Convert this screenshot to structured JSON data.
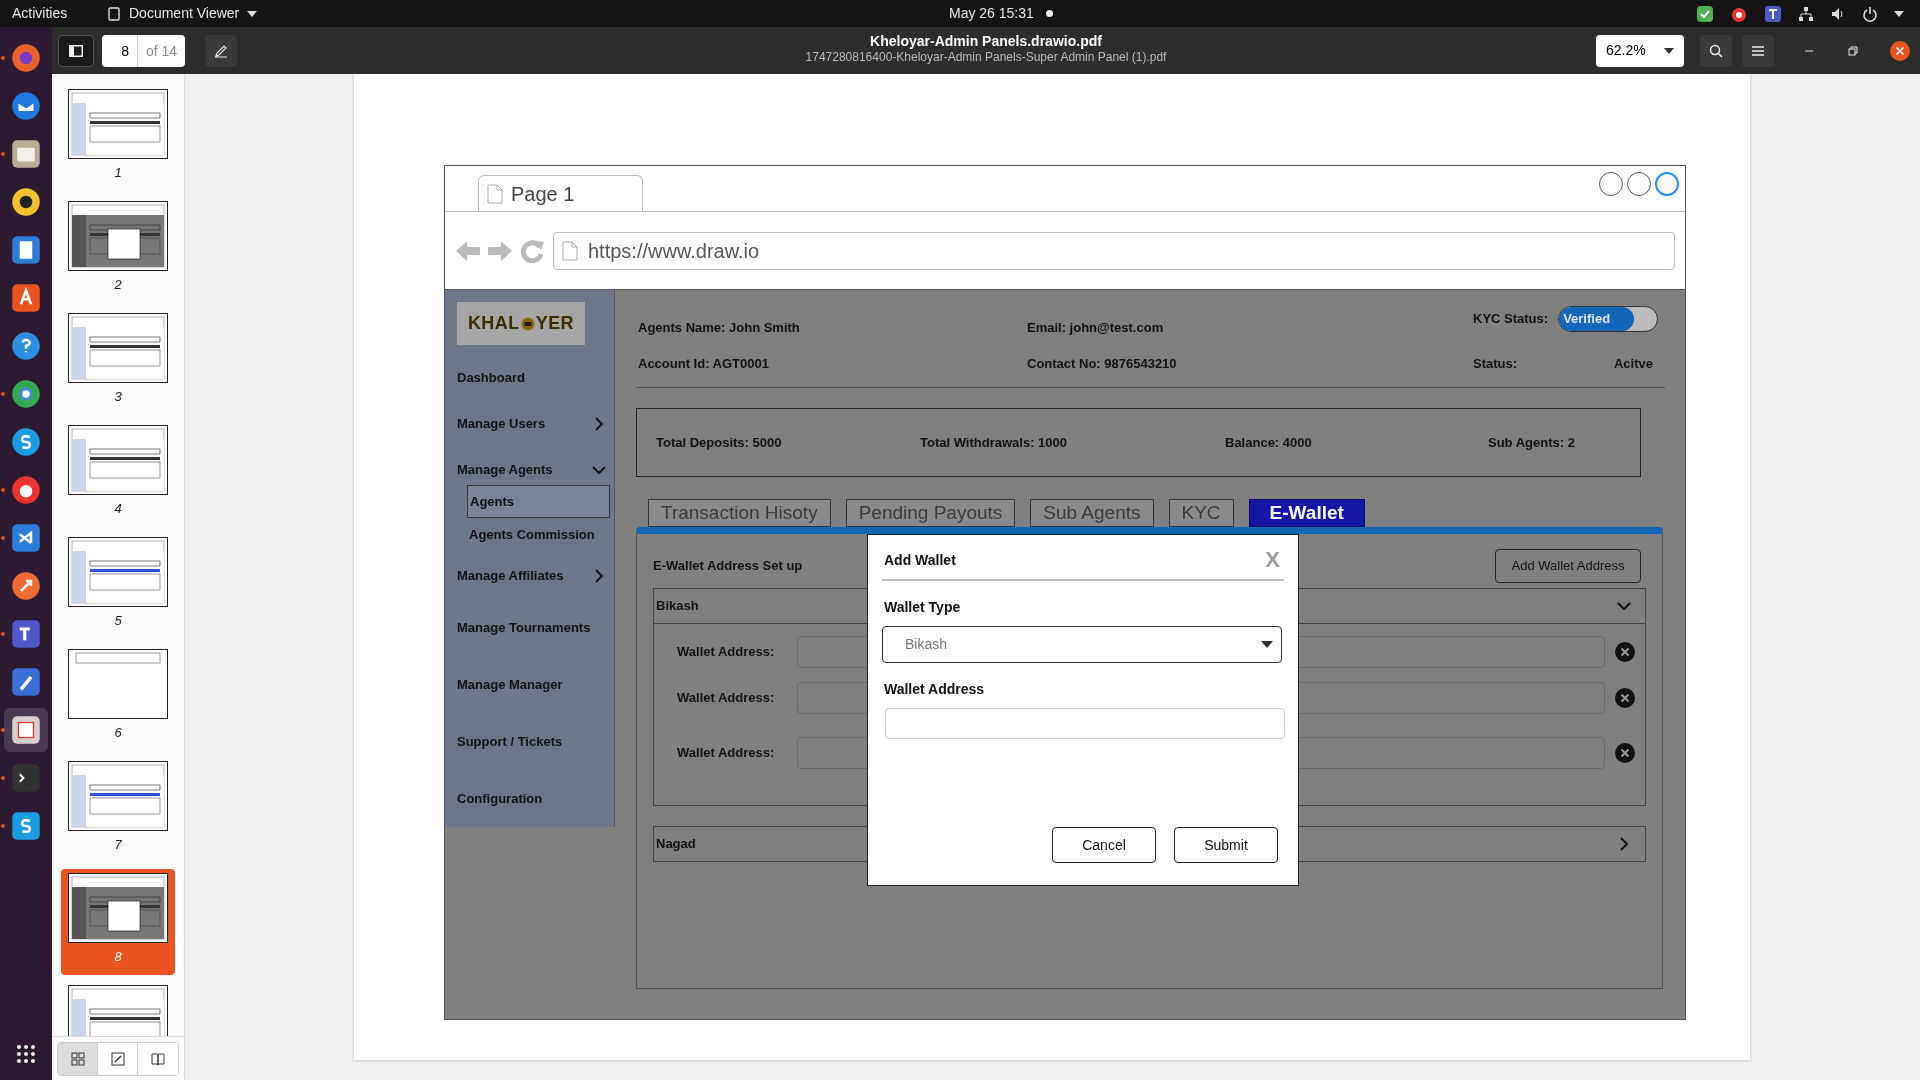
{
  "topbar": {
    "activities": "Activities",
    "app": "Document Viewer",
    "clock": "May 26  15:31"
  },
  "dock": [
    {
      "running": true
    },
    {
      "running": false
    },
    {
      "running": true
    },
    {
      "running": false
    },
    {
      "running": false
    },
    {
      "running": false
    },
    {
      "running": false
    },
    {
      "running": true
    },
    {
      "running": false
    },
    {
      "running": true
    },
    {
      "running": true
    },
    {
      "running": false
    },
    {
      "running": true
    },
    {
      "running": false
    },
    {
      "running": true
    },
    {
      "running": true
    },
    {
      "running": true
    }
  ],
  "viewer": {
    "page": "8",
    "page_count": "of 14",
    "title": "Kheloyar-Admin Panels.drawio.pdf",
    "subtitle": "1747280816400-Kheloyar-Admin Panels-Super Admin Panel (1).pdf",
    "zoom": "62.2%"
  },
  "thumbnails": [
    {
      "label": "1",
      "selected": false
    },
    {
      "label": "2",
      "selected": false
    },
    {
      "label": "3",
      "selected": false
    },
    {
      "label": "4",
      "selected": false
    },
    {
      "label": "5",
      "selected": false
    },
    {
      "label": "6",
      "selected": false
    },
    {
      "label": "7",
      "selected": false
    },
    {
      "label": "8",
      "selected": true
    },
    {
      "selected": false
    }
  ],
  "sidebar_modes": [
    {
      "selected": true
    },
    {
      "selected": false
    },
    {
      "selected": false
    }
  ],
  "mockup": {
    "tab": "Page 1",
    "url": "https://www.draw.io",
    "logo": [
      "KHAL",
      "YER"
    ],
    "nav": [
      {
        "label": "Dashboard"
      },
      {
        "label": "Manage Users",
        "expanded": false
      },
      {
        "label": "Manage Agents",
        "expanded": true,
        "children": [
          {
            "label": "Agents",
            "selected": true
          },
          {
            "label": "Agents Commission",
            "selected": false
          }
        ]
      },
      {
        "label": "Manage Affiliates",
        "expanded": false
      },
      {
        "label": "Manage Tournaments"
      },
      {
        "label": "Manage Manager"
      },
      {
        "label": "Support / Tickets"
      },
      {
        "label": "Configuration"
      }
    ],
    "agent": {
      "name": "Agents Name: John Smith",
      "account": "Account Id: AGT0001",
      "email": "Email: john@test.com",
      "contact": "Contact No: 9876543210",
      "kyc_label": "KYC Status:",
      "kyc_toggle": "Verified",
      "kyc_on": true,
      "status_label": "Status:",
      "status": "Acitve"
    },
    "summary": [
      "Total Deposits: 5000",
      "Total Withdrawals: 1000",
      "Balance: 4000",
      "Sub Agents: 2"
    ],
    "tabs": [
      {
        "label": "Transaction Hisoty",
        "selected": false
      },
      {
        "label": "Pending Payouts",
        "selected": false
      },
      {
        "label": "Sub Agents",
        "selected": false
      },
      {
        "label": "KYC",
        "selected": false
      },
      {
        "label": "E-Wallet",
        "selected": true
      }
    ],
    "wallet": {
      "title": "E-Wallet Address Set up",
      "add_button": "Add Wallet Address",
      "groups": [
        {
          "name": "Bikash",
          "expanded": true,
          "addresses": [
            {
              "label": "Wallet Address:"
            },
            {
              "label": "Wallet Address:"
            },
            {
              "label": "Wallet Address:"
            }
          ]
        },
        {
          "name": "Nagad",
          "expanded": false
        }
      ]
    },
    "modal": {
      "title": "Add Wallet",
      "close": "X",
      "fields": [
        {
          "kind": "select",
          "label": "Wallet Type",
          "value": "Bikash"
        },
        {
          "kind": "input",
          "label": "Wallet Address"
        }
      ],
      "buttons": [
        "Cancel",
        "Submit"
      ]
    }
  }
}
